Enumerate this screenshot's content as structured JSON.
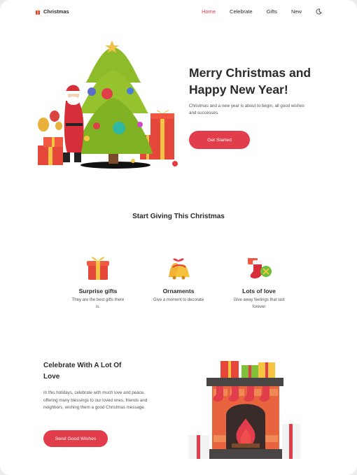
{
  "nav": {
    "brand": "Christmas",
    "links": [
      {
        "label": "Home",
        "active": true
      },
      {
        "label": "Celebrate",
        "active": false
      },
      {
        "label": "Gifts",
        "active": false
      },
      {
        "label": "New",
        "active": false
      }
    ],
    "theme_toggle_icon": "moon-icon"
  },
  "hero": {
    "title": "Merry Christmas and Happy New Year!",
    "description": "Christmas and a new year is about to begin, all good wishes and successes.",
    "cta_label": "Get Started",
    "image_icon": "christmas-tree-santa-illustration"
  },
  "giving": {
    "title": "Start Giving This Christmas",
    "cards": [
      {
        "title": "Surprise gifts",
        "description": "They are the best gifts there is.",
        "icon": "gift-box-icon"
      },
      {
        "title": "Ornaments",
        "description": "Give a moment to decorate",
        "icon": "bells-icon"
      },
      {
        "title": "Lots of love",
        "description": "Give away feelings that last forever",
        "icon": "stocking-icon"
      }
    ]
  },
  "love": {
    "title": "Celebrate With A Lot Of Love",
    "description": "In this holidays, celebrate with much love and peace, offering many blessings to our loved ones, friends and neighbors, wishing them a good Christmas message.",
    "cta_label": "Send Good Wishes",
    "image_icon": "fireplace-illustration"
  },
  "colors": {
    "accent": "#e23d4b",
    "text": "#2b2b2b",
    "muted": "#555555",
    "background": "#ffffff"
  }
}
